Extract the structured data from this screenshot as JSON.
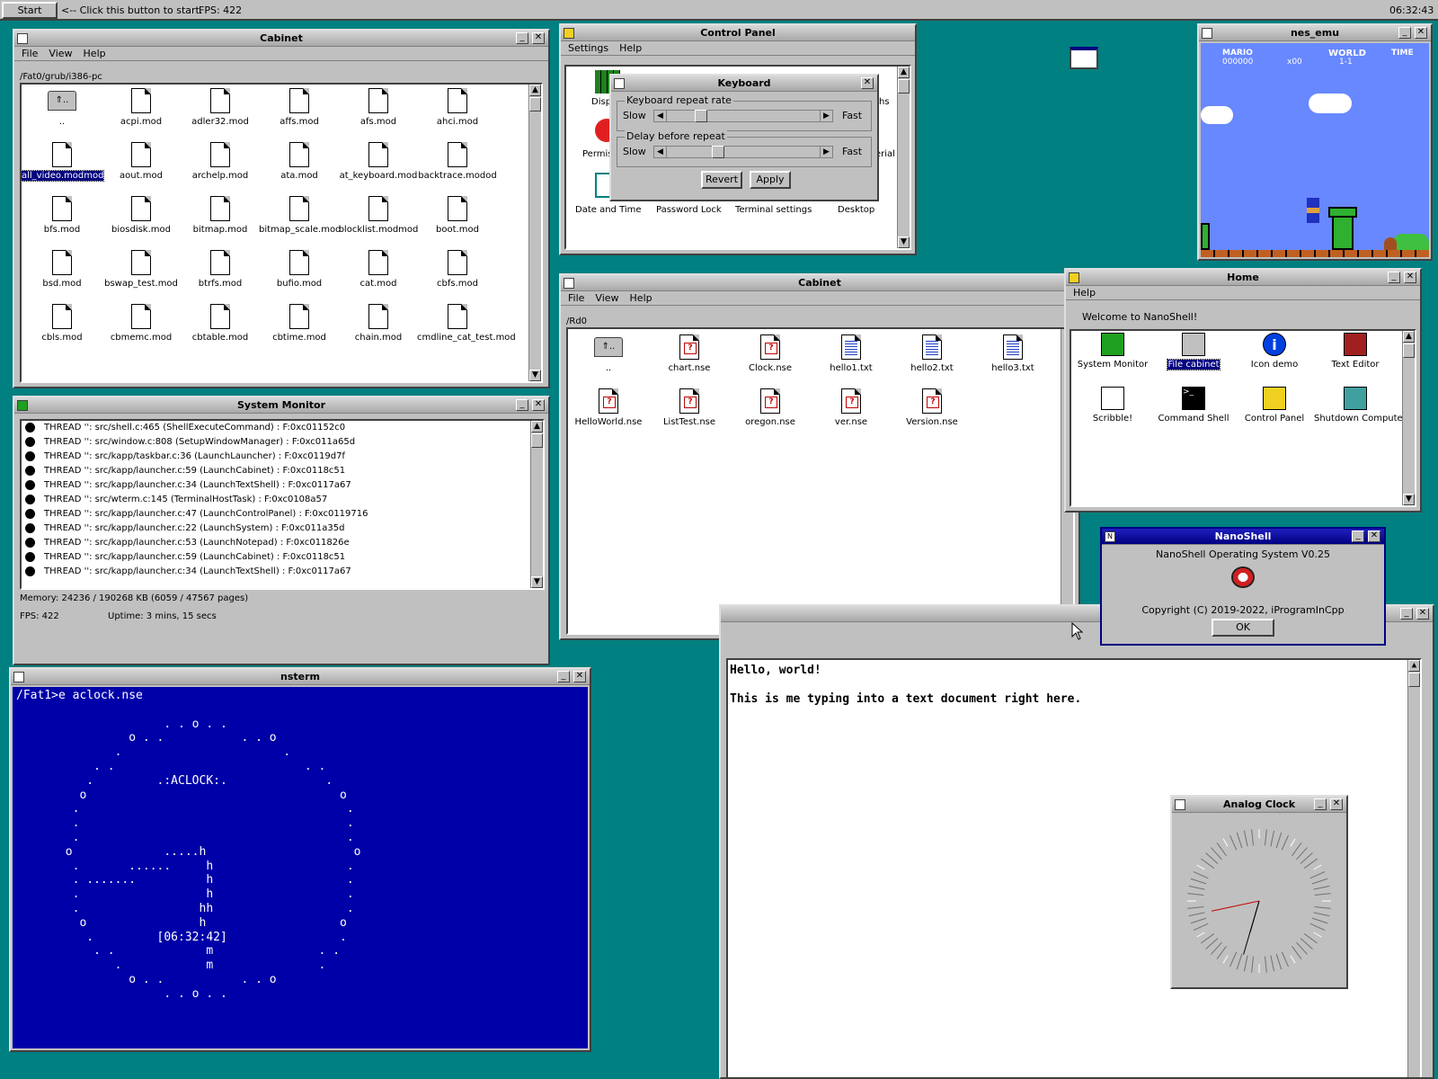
{
  "taskbar": {
    "start": "Start",
    "hint": "<-- Click this button to start.",
    "fps": "FPS: 422",
    "clock": "06:32:43"
  },
  "cabinet1": {
    "title": "Cabinet",
    "menu": [
      "File",
      "View",
      "Help"
    ],
    "path": "/Fat0/grub/i386-pc",
    "files": [
      "..",
      "acpi.mod",
      "adler32.mod",
      "affs.mod",
      "afs.mod",
      "ahci.mod",
      "all_video.modmod",
      "aout.mod",
      "archelp.mod",
      "ata.mod",
      "at_keyboard.mod",
      "backtrace.modod",
      "bfs.mod",
      "biosdisk.mod",
      "bitmap.mod",
      "bitmap_scale.mod",
      "blocklist.modmod",
      "boot.mod",
      "bsd.mod",
      "bswap_test.mod",
      "btrfs.mod",
      "bufio.mod",
      "cat.mod",
      "cbfs.mod",
      "cbls.mod",
      "cbmemc.mod",
      "cbtable.mod",
      "cbtime.mod",
      "chain.mod",
      "cmdline_cat_test.mod"
    ]
  },
  "control_panel": {
    "title": "Control Panel",
    "menu": [
      "Settings",
      "Help"
    ],
    "items": [
      "Displ",
      "Permis",
      "Date and Time",
      "Password Lock",
      "Terminal settings",
      "Desktop",
      "hs",
      "erial"
    ]
  },
  "keyboard": {
    "title": "Keyboard",
    "group1": "Keyboard repeat rate",
    "group2": "Delay before repeat",
    "slow": "Slow",
    "fast": "Fast",
    "revert": "Revert",
    "apply": "Apply",
    "rate_level": 0.2,
    "delay_level": 0.32
  },
  "nes": {
    "title": "nes_emu",
    "mario": "MARIO",
    "score": "000000",
    "coins": "x00",
    "world": "WORLD",
    "world_num": "1-1",
    "time": "TIME"
  },
  "cabinet2": {
    "title": "Cabinet",
    "menu": [
      "File",
      "View",
      "Help"
    ],
    "path": "/Rd0",
    "files": [
      {
        "n": "..",
        "t": "up"
      },
      {
        "n": "chart.nse",
        "t": "exe"
      },
      {
        "n": "Clock.nse",
        "t": "exe"
      },
      {
        "n": "hello1.txt",
        "t": "txt"
      },
      {
        "n": "hello2.txt",
        "t": "txt"
      },
      {
        "n": "hello3.txt",
        "t": "txt"
      },
      {
        "n": "HelloWorld.nse",
        "t": "exe"
      },
      {
        "n": "ListTest.nse",
        "t": "exe"
      },
      {
        "n": "oregon.nse",
        "t": "exe"
      },
      {
        "n": "ver.nse",
        "t": "exe"
      },
      {
        "n": "Version.nse",
        "t": "exe"
      }
    ]
  },
  "home": {
    "title": "Home",
    "menu": [
      "Help"
    ],
    "welcome": "Welcome to NanoShell!",
    "items": [
      {
        "n": "System Monitor",
        "c": "#20a020"
      },
      {
        "n": "File cabinet",
        "c": "#c0c0c0"
      },
      {
        "n": "Icon demo",
        "c": "#0040e0"
      },
      {
        "n": "Text Editor",
        "c": "#a02020"
      },
      {
        "n": "Scribble!",
        "c": "#ffffff"
      },
      {
        "n": "Command Shell",
        "c": "#000000"
      },
      {
        "n": "Control Panel",
        "c": "#f0d020"
      },
      {
        "n": "Shutdown Computer",
        "c": "#40a0a0"
      }
    ]
  },
  "about": {
    "title": "NanoShell",
    "line1": "NanoShell Operating System V0.25",
    "line2": "Copyright (C) 2019-2022, iProgramInCpp",
    "ok": "OK"
  },
  "sysmon": {
    "title": "System Monitor",
    "threads": [
      "THREAD '': src/shell.c:465 (ShellExecuteCommand) : F:0xc01152c0",
      "THREAD '': src/window.c:808 (SetupWindowManager) : F:0xc011a65d",
      "THREAD '': src/kapp/taskbar.c:36 (LaunchLauncher) : F:0xc0119d7f",
      "THREAD '': src/kapp/launcher.c:59 (LaunchCabinet) : F:0xc0118c51",
      "THREAD '': src/kapp/launcher.c:34 (LaunchTextShell) : F:0xc0117a67",
      "THREAD '': src/wterm.c:145 (TerminalHostTask) : F:0xc0108a57",
      "THREAD '': src/kapp/launcher.c:47 (LaunchControlPanel) : F:0xc0119716",
      "THREAD '': src/kapp/launcher.c:22 (LaunchSystem) : F:0xc011a35d",
      "THREAD '': src/kapp/launcher.c:53 (LaunchNotepad) : F:0xc011826e",
      "THREAD '': src/kapp/launcher.c:59 (LaunchCabinet) : F:0xc0118c51",
      "THREAD '': src/kapp/launcher.c:34 (LaunchTextShell) : F:0xc0117a67"
    ],
    "memory": "Memory: 24236 / 190268 KB (6059 / 47567 pages)",
    "fps": "FPS: 422",
    "uptime": "Uptime: 3 mins, 15 secs"
  },
  "nsterm": {
    "title": "nsterm",
    "lines": [
      "/Fat1>e aclock.nse",
      "",
      "                     . . o . .",
      "                o . .           . . o",
      "              .                       .",
      "           . .                           . .",
      "          .         .:ACLOCK:.              .",
      "         o                                    o",
      "        .                                      .",
      "        .                                      .",
      "        .                                      .",
      "       o             .....h                     o",
      "        .       ......     h                   .",
      "        . .......          h                   .",
      "        .                  h                   .",
      "        .                 hh                   .",
      "         o                h                   o",
      "          .         [06:32:42]                .",
      "           . .             m               . .",
      "              .            m               .",
      "                o . .           . . o",
      "                     . . o . ."
    ]
  },
  "editor": {
    "line1": "Hello, world!",
    "line2": "This is me typing into a text document right here."
  },
  "analog_clock": {
    "title": "Analog Clock",
    "time": "06:32:43"
  }
}
